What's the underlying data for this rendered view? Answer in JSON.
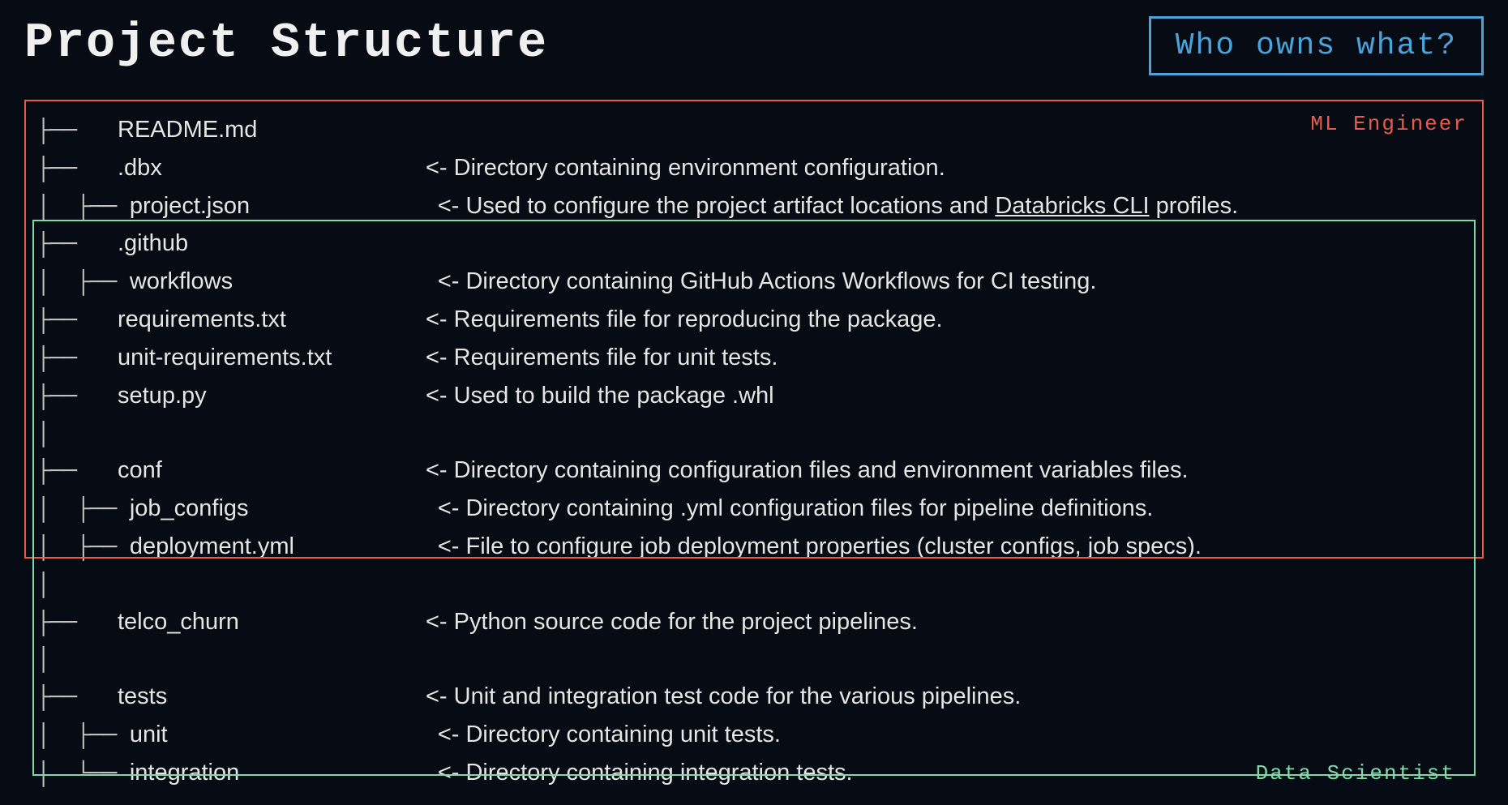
{
  "title": "Project Structure",
  "who_owns": "Who owns what?",
  "labels": {
    "ml_engineer": "ML Engineer",
    "data_scientist": "Data Scientist"
  },
  "tree": [
    {
      "prefix": "├── ",
      "name": "README.md",
      "desc": ""
    },
    {
      "prefix": "├── ",
      "name": ".dbx",
      "desc": "<- Directory containing environment configuration."
    },
    {
      "prefix": "│  ├── ",
      "name": "project.json",
      "desc_pre": "<- Used to configure the project artifact locations and ",
      "link": "Databricks CLI",
      "desc_post": " profiles."
    },
    {
      "prefix": "├── ",
      "name": ".github",
      "desc": ""
    },
    {
      "prefix": "│  ├── ",
      "name": "workflows",
      "desc": "<- Directory containing GitHub Actions Workflows for CI testing."
    },
    {
      "prefix": "├── ",
      "name": "requirements.txt",
      "desc": "<- Requirements file for reproducing the package."
    },
    {
      "prefix": "├── ",
      "name": "unit-requirements.txt",
      "desc": "<- Requirements file for unit tests."
    },
    {
      "prefix": "├── ",
      "name": "setup.py",
      "desc": "<- Used to build the package .whl"
    },
    {
      "spacer": "│"
    },
    {
      "prefix": "├── ",
      "name": "conf",
      "desc": "<- Directory containing configuration files and environment variables files."
    },
    {
      "prefix": "│  ├── ",
      "name": "job_configs",
      "desc": "<- Directory containing .yml configuration files for pipeline definitions."
    },
    {
      "prefix": "│  ├── ",
      "name": "deployment.yml",
      "desc": "<- File to configure job deployment properties (cluster configs, job specs)."
    },
    {
      "spacer": "│"
    },
    {
      "prefix": "├── ",
      "name": "telco_churn",
      "desc": "<- Python source code for the project pipelines."
    },
    {
      "spacer": "│"
    },
    {
      "prefix": "├── ",
      "name": "tests",
      "desc": "<- Unit and integration test code for the various pipelines."
    },
    {
      "prefix": "│  ├── ",
      "name": "unit",
      "desc": "<- Directory containing unit tests."
    },
    {
      "prefix": "│  └── ",
      "name": "integration",
      "desc": "<- Directory containing integration tests."
    }
  ]
}
